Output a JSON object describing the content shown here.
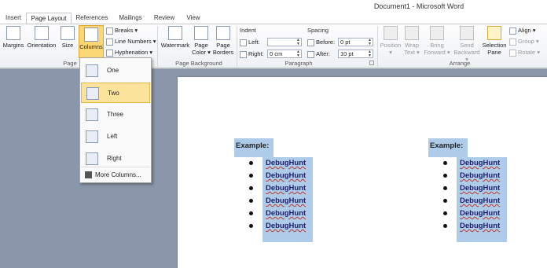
{
  "window": {
    "title": "Document1 - Microsoft Word"
  },
  "tabs": [
    {
      "label": "Insert"
    },
    {
      "label": "Page Layout"
    },
    {
      "label": "References"
    },
    {
      "label": "Mailings"
    },
    {
      "label": "Review"
    },
    {
      "label": "View"
    }
  ],
  "ribbon": {
    "page_setup": {
      "label": "Page Se",
      "margins": "Margins",
      "orientation": "Orientation",
      "size": "Size",
      "columns": "Columns",
      "breaks": "Breaks",
      "line_numbers": "Line Numbers",
      "hyphenation": "Hyphenation"
    },
    "page_background": {
      "label": "Page Background",
      "watermark": "Watermark",
      "page_color_1": "Page",
      "page_color_2": "Color",
      "page_borders_1": "Page",
      "page_borders_2": "Borders"
    },
    "paragraph": {
      "label": "Paragraph",
      "indent": "Indent",
      "left_label": "Left:",
      "left_value": "",
      "right_label": "Right:",
      "right_value": "0 cm",
      "spacing": "Spacing",
      "before_label": "Before:",
      "before_value": "0 pt",
      "after_label": "After:",
      "after_value": "10 pt"
    },
    "arrange": {
      "label": "Arrange",
      "position": "Position",
      "wrap_1": "Wrap",
      "wrap_2": "Text",
      "bring_1": "Bring",
      "bring_2": "Forward",
      "send_1": "Send",
      "send_2": "Backward",
      "selection_1": "Selection",
      "selection_2": "Pane",
      "align": "Align",
      "group": "Group",
      "rotate": "Rotate"
    }
  },
  "columns_menu": {
    "items": [
      {
        "label": "One",
        "selected": false
      },
      {
        "label": "Two",
        "selected": true
      },
      {
        "label": "Three",
        "selected": false
      },
      {
        "label": "Left",
        "selected": false
      },
      {
        "label": "Right",
        "selected": false
      }
    ],
    "more": "More Columns..."
  },
  "document": {
    "columns": [
      {
        "heading": "Example:",
        "items": [
          "DebugHunt",
          "DebugHunt",
          "DebugHunt",
          "DebugHunt",
          "DebugHunt",
          "DebugHunt"
        ]
      },
      {
        "heading": "Example:",
        "items": [
          "DebugHunt",
          "DebugHunt",
          "DebugHunt",
          "DebugHunt",
          "DebugHunt",
          "DebugHunt"
        ]
      }
    ]
  }
}
